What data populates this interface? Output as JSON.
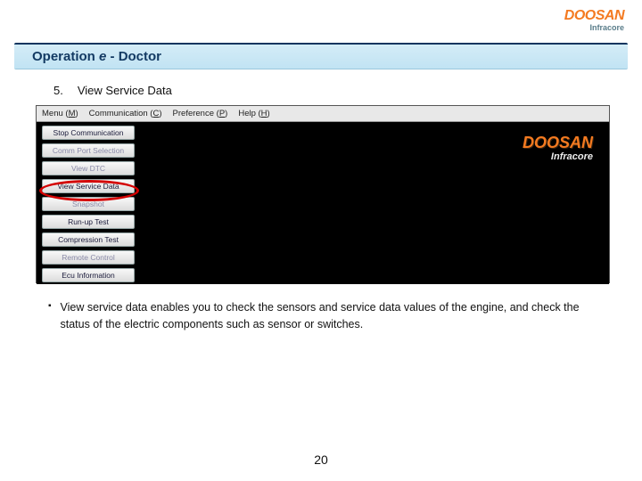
{
  "header": {
    "logo_main": "DOOSAN",
    "logo_sub": "Infracore",
    "title_prefix": "Operation ",
    "title_em": "e",
    "title_suffix": " - Doctor"
  },
  "section": {
    "number": "5.",
    "label": "View Service Data"
  },
  "app": {
    "menubar": {
      "menu": {
        "label": "Menu (",
        "key": "M",
        "close": ")"
      },
      "comm": {
        "label": "Communication (",
        "key": "C",
        "close": ")"
      },
      "pref": {
        "label": "Preference (",
        "key": "P",
        "close": ")"
      },
      "help": {
        "label": "Help (",
        "key": "H",
        "close": ")"
      }
    },
    "side": {
      "stop_comm": "Stop Communication",
      "comm_port": "Comm Port Selection",
      "view_dtc": "View DTC",
      "view_service_data": "View Service Data",
      "snapshot": "Snapshot",
      "runup": "Run-up Test",
      "compression": "Compression Test",
      "remote": "Remote Control",
      "ecu_info": "Ecu Information"
    },
    "app_logo": {
      "main": "DOOSAN",
      "sub": "Infracore"
    }
  },
  "description": {
    "bullet": "▪",
    "text": "View service data enables you to check the sensors and service data values of the engine, and check the status of the electric components such as sensor or switches."
  },
  "page_number": "20"
}
